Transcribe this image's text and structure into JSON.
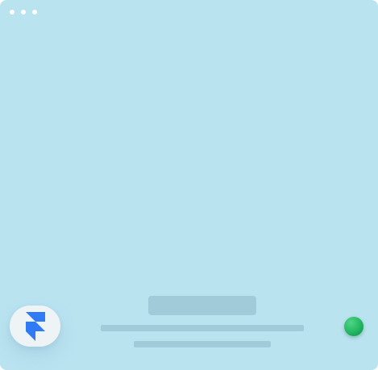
{
  "window": {
    "background_color": "#bae3f0",
    "controls": [
      {
        "icon": "window-dot"
      },
      {
        "icon": "window-dot"
      },
      {
        "icon": "window-dot"
      }
    ]
  },
  "skeleton": {
    "block_color": "#a1cbd8",
    "line_color": "#a1cbd8"
  },
  "app_icon": {
    "icon": "framer-logo-icon",
    "color": "#2f7bf5"
  },
  "status_indicator": {
    "icon": "status-dot",
    "color": "#22b660"
  }
}
